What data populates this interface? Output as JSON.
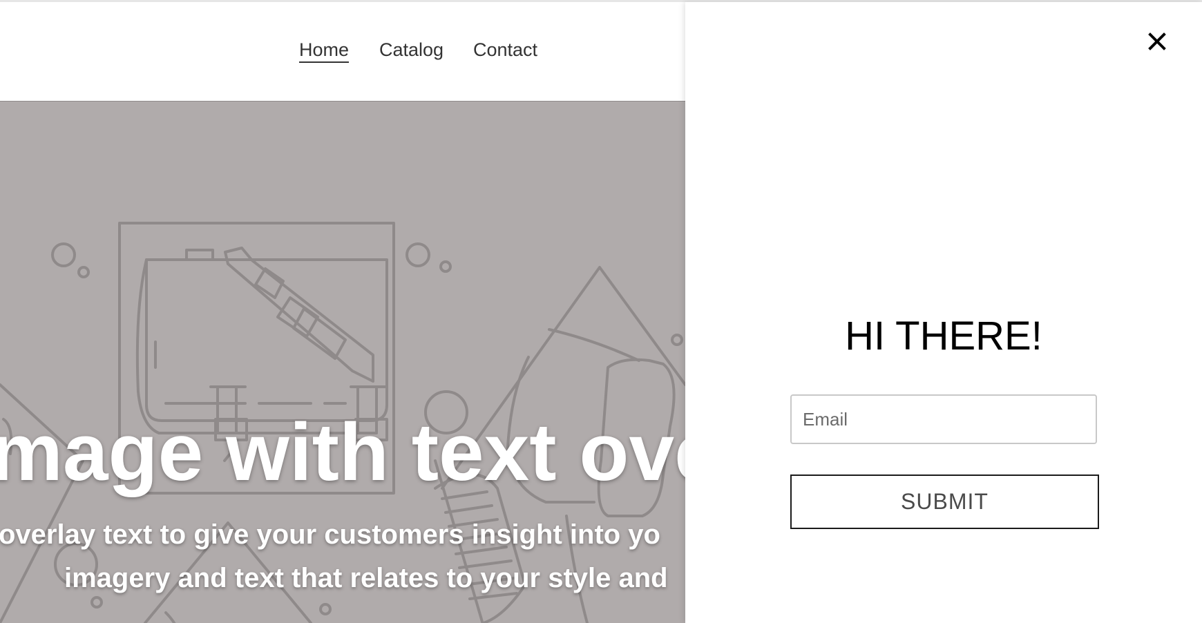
{
  "nav": {
    "items": [
      {
        "label": "Home",
        "active": true
      },
      {
        "label": "Catalog",
        "active": false
      },
      {
        "label": "Contact",
        "active": false
      }
    ]
  },
  "hero": {
    "title": "mage with text ove",
    "text_line_1": "overlay text to give your customers insight into yo",
    "text_line_2": "imagery and text that relates to your style and",
    "background_color": "#b0abab",
    "illustration_icon": "bag-illustration-icon"
  },
  "drawer": {
    "close_icon": "close-icon",
    "greeting": "HI THERE!",
    "email_placeholder": "Email",
    "email_value": "",
    "submit_label": "SUBMIT"
  },
  "colors": {
    "text": "#333333",
    "hero_overlay": "#b0abab",
    "line_art": "#8f8a8a",
    "submit_border": "#1a1a1a"
  }
}
